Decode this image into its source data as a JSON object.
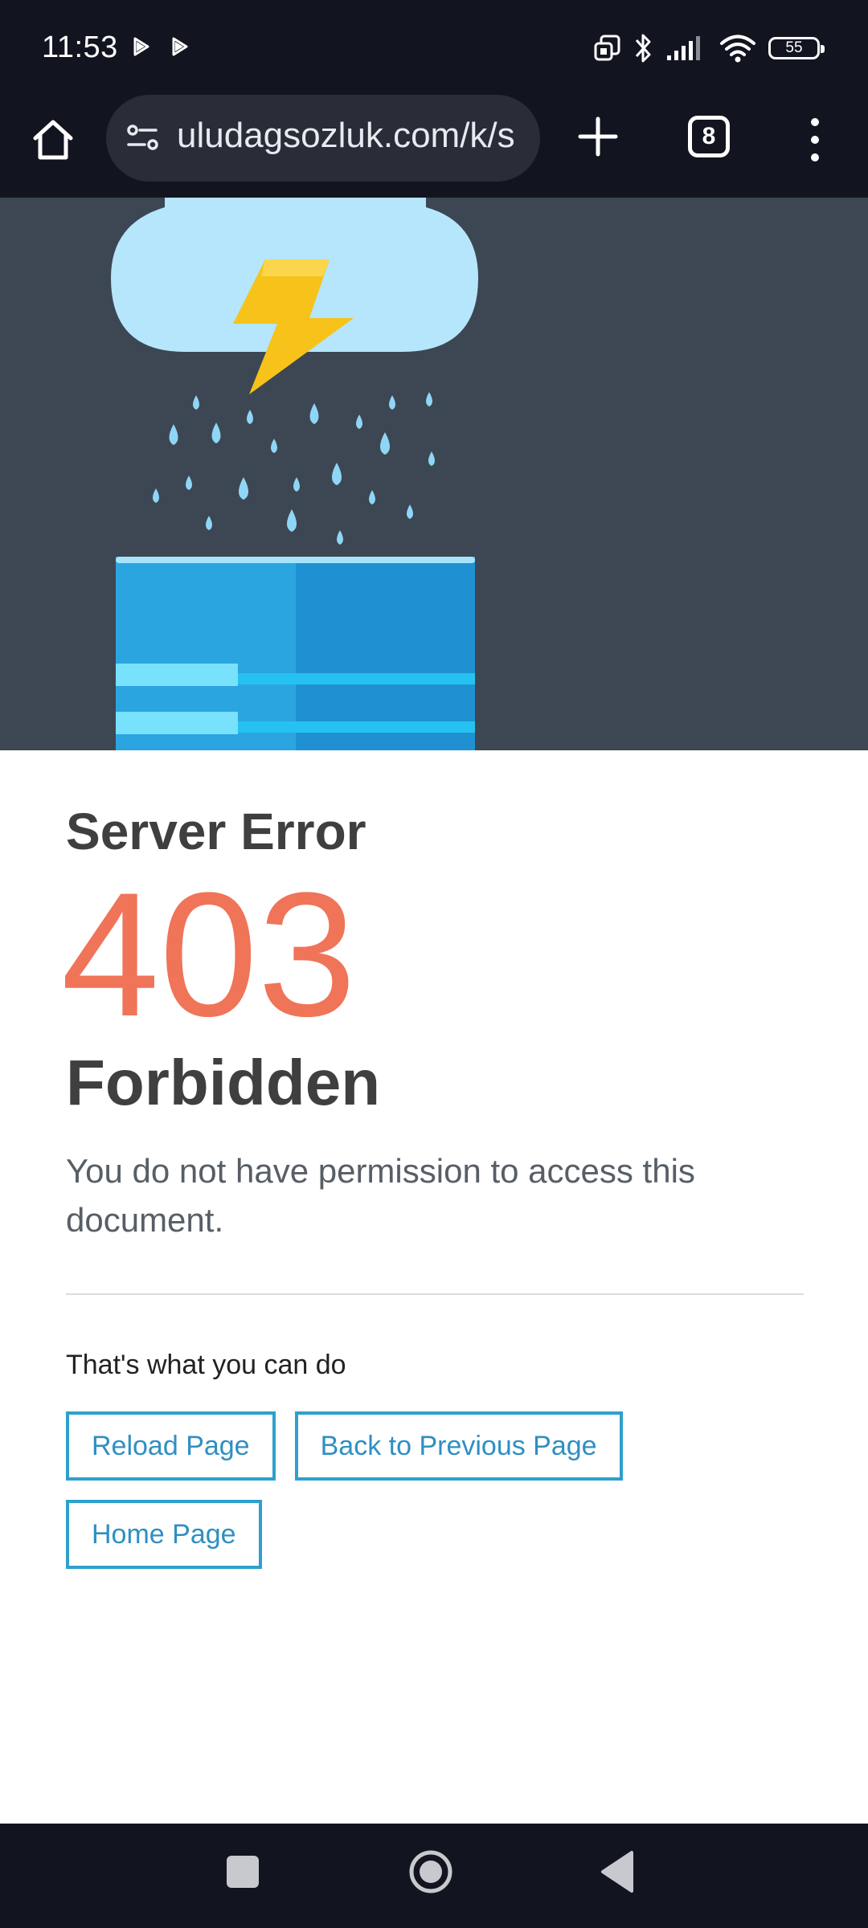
{
  "status_bar": {
    "time": "11:53",
    "battery": "55",
    "icons": [
      "play-icon",
      "play-icon",
      "screen-mirror-icon",
      "bluetooth-icon",
      "signal-icon",
      "wifi-icon",
      "battery-icon"
    ]
  },
  "browser": {
    "url": "uludagsozluk.com/k/s",
    "tab_count": "8",
    "icons": [
      "home-icon",
      "site-settings-icon",
      "new-tab-icon",
      "tabs-icon",
      "more-menu-icon"
    ]
  },
  "error": {
    "heading": "Server Error",
    "code": "403",
    "title": "Forbidden",
    "description": "You do not have permission to access this document."
  },
  "actions": {
    "title": "That's what you can do",
    "reload_label": "Reload Page",
    "back_label": "Back to Previous Page",
    "home_label": "Home Page"
  },
  "colors": {
    "bar_background": "#121520",
    "hero_background": "#3c4753",
    "error_code": "#f07458",
    "button_border": "#2fa0cd",
    "lightning": "#f7c21a",
    "cloud": "#b5e6fb",
    "drop": "#8fd6f6",
    "server": "#1f91d3"
  },
  "nav_bar": {
    "icons": [
      "recent-apps-icon",
      "home-circle-icon",
      "back-triangle-icon"
    ]
  }
}
